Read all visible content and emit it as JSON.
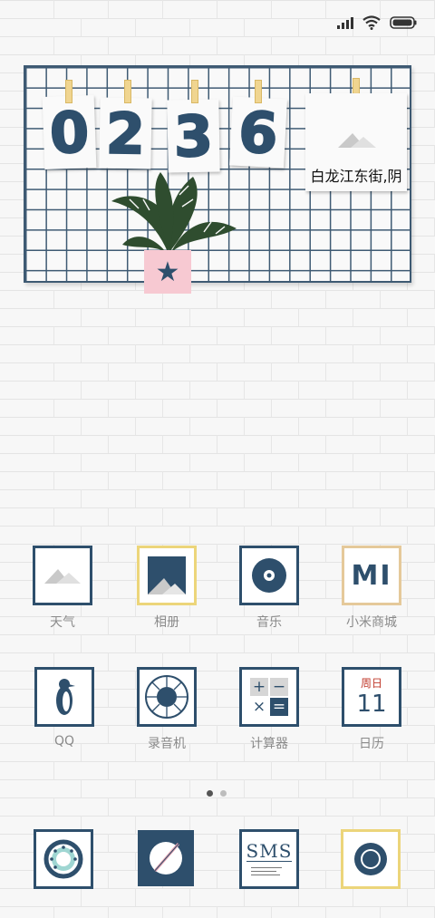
{
  "status_bar": {
    "icons": [
      "signal-icon",
      "wifi-icon",
      "battery-icon"
    ]
  },
  "widget": {
    "clock_digits": [
      "0",
      "2",
      "3",
      "6"
    ],
    "weather_location": "白龙江东街,阴",
    "weather_icon": "mountain-icon",
    "colors": {
      "grid": "#3e5a73",
      "digit": "#2e4f6c",
      "pot": "#f7c9d2",
      "clip": "#f0d590"
    }
  },
  "apps": [
    {
      "label": "天气",
      "icon": "weather-icon"
    },
    {
      "label": "相册",
      "icon": "gallery-icon"
    },
    {
      "label": "音乐",
      "icon": "music-icon"
    },
    {
      "label": "小米商城",
      "icon": "mi-store-icon"
    },
    {
      "label": "QQ",
      "icon": "qq-penguin-icon"
    },
    {
      "label": "录音机",
      "icon": "recorder-icon"
    },
    {
      "label": "计算器",
      "icon": "calculator-icon"
    },
    {
      "label": "日历",
      "icon": "calendar-icon",
      "weekday": "周日",
      "day": "11"
    }
  ],
  "calculator_symbols": [
    "+",
    "−",
    "×",
    "="
  ],
  "mi_logo": "MI",
  "page_indicator": {
    "pages": 2,
    "current": 1
  },
  "dock": [
    {
      "icon": "phone-icon"
    },
    {
      "icon": "browser-icon"
    },
    {
      "icon": "sms-icon",
      "text": "SMS"
    },
    {
      "icon": "camera-icon"
    }
  ]
}
